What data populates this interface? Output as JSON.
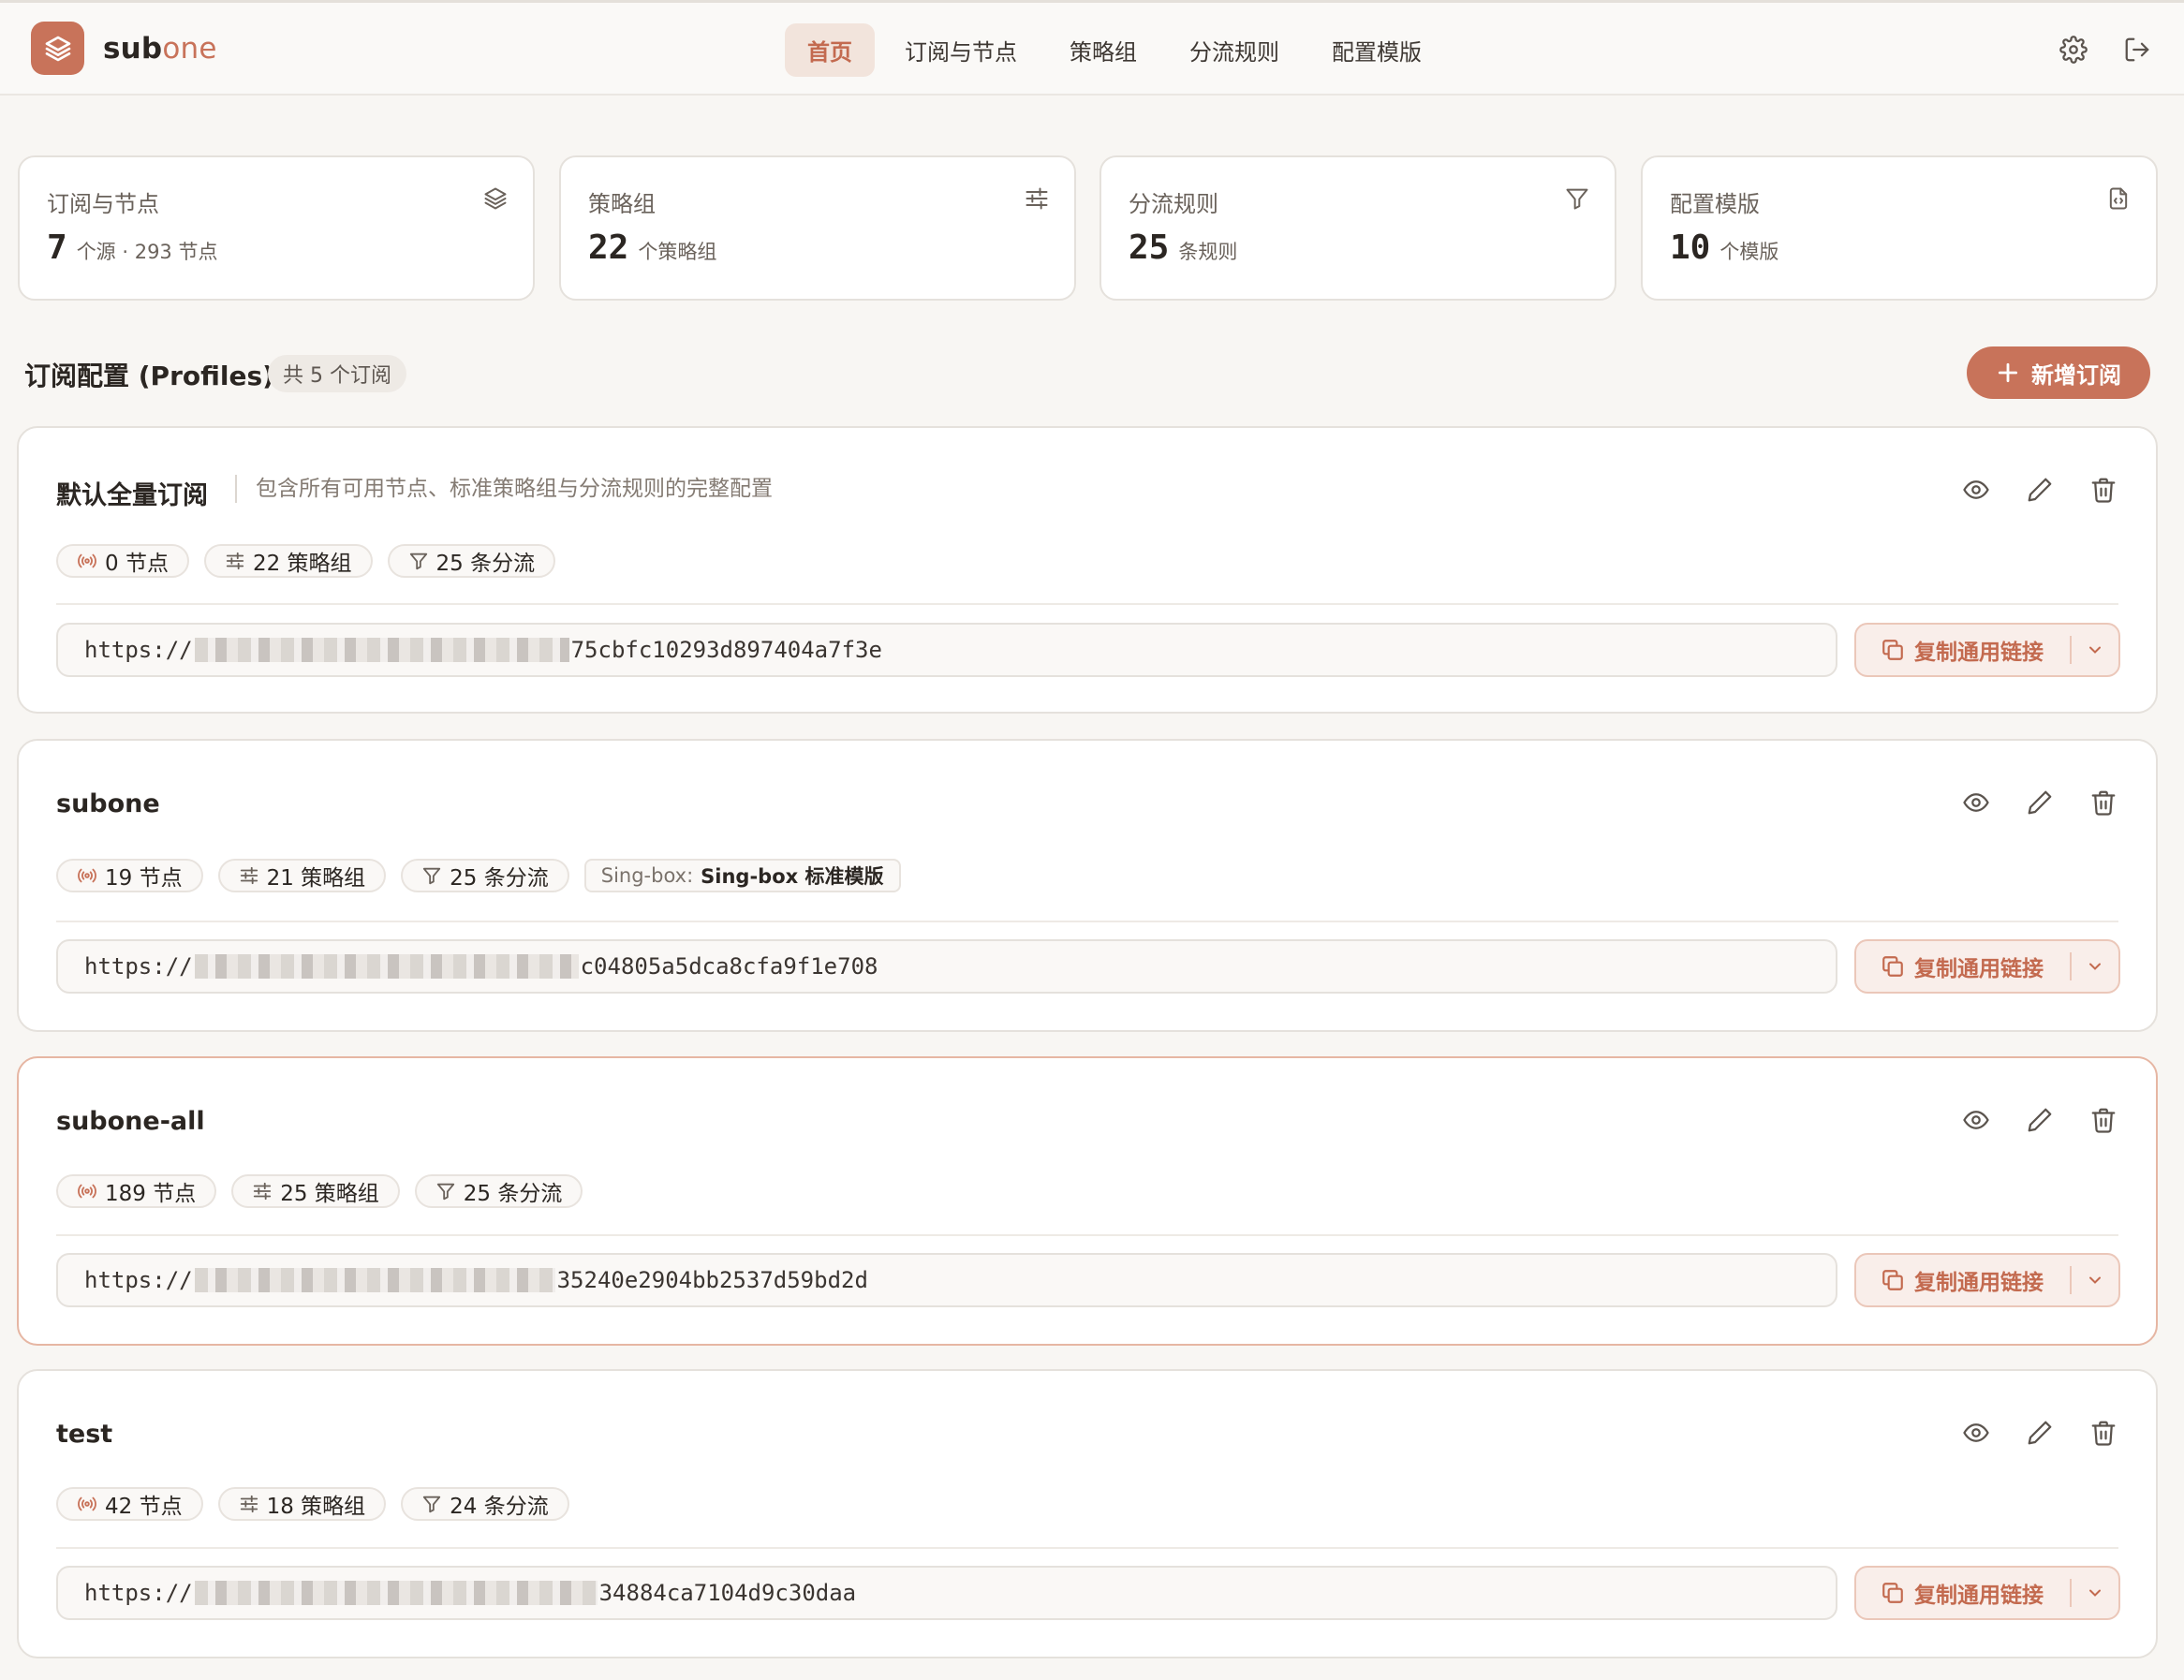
{
  "app": {
    "brand_main": "sub",
    "brand_accent": "one"
  },
  "nav": [
    {
      "label": "首页",
      "active": true
    },
    {
      "label": "订阅与节点"
    },
    {
      "label": "策略组"
    },
    {
      "label": "分流规则"
    },
    {
      "label": "配置模版"
    }
  ],
  "stats": [
    {
      "title": "订阅与节点",
      "value": "7",
      "sub": "个源 · 293 节点",
      "icon": "layers-icon"
    },
    {
      "title": "策略组",
      "value": "22",
      "sub": "个策略组",
      "icon": "sliders-icon"
    },
    {
      "title": "分流规则",
      "value": "25",
      "sub": "条规则",
      "icon": "filter-icon"
    },
    {
      "title": "配置模版",
      "value": "10",
      "sub": "个模版",
      "icon": "file-code-icon"
    }
  ],
  "section": {
    "title": "订阅配置 (Profiles)",
    "badge": "共 5 个订阅",
    "add_label": "新增订阅"
  },
  "profiles": [
    {
      "name": "默认全量订阅",
      "description": "包含所有可用节点、标准策略组与分流规则的完整配置",
      "nodes": "0 节点",
      "groups": "22 策略组",
      "rules": "25 条分流",
      "url_prefix": "https://",
      "url_suffix": "75cbfc10293d897404a7f3e",
      "copy_label": "复制通用链接"
    },
    {
      "name": "subone",
      "nodes": "19 节点",
      "groups": "21 策略组",
      "rules": "25 条分流",
      "template_label": "Sing-box:",
      "template_value": "Sing-box 标准模版",
      "url_prefix": "https://",
      "url_suffix": "c04805a5dca8cfa9f1e708",
      "copy_label": "复制通用链接"
    },
    {
      "name": "subone-all",
      "nodes": "189 节点",
      "groups": "25 策略组",
      "rules": "25 条分流",
      "url_prefix": "https://",
      "url_suffix": "35240e2904bb2537d59bd2d",
      "copy_label": "复制通用链接"
    },
    {
      "name": "test",
      "nodes": "42 节点",
      "groups": "18 策略组",
      "rules": "24 条分流",
      "url_prefix": "https://",
      "url_suffix": "34884ca7104d9c30daa",
      "copy_label": "复制通用链接"
    }
  ],
  "colors": {
    "accent": "#c8735a",
    "background": "#f8f6f3",
    "card": "#ffffff"
  }
}
